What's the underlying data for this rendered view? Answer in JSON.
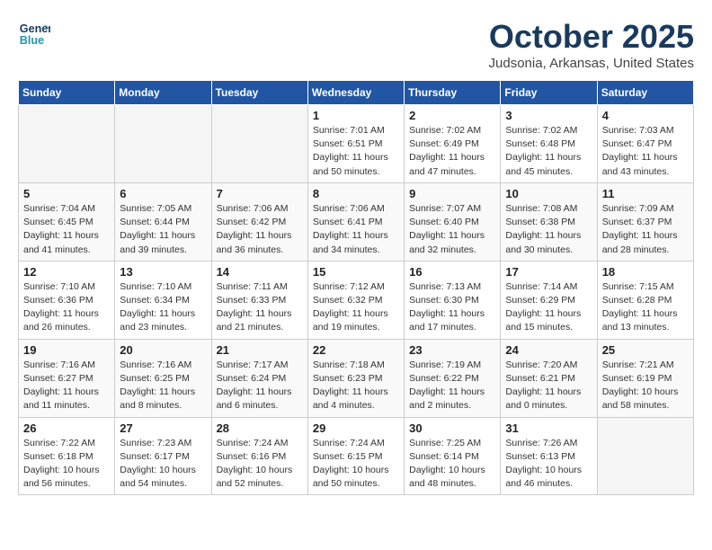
{
  "logo": {
    "line1": "General",
    "line2": "Blue"
  },
  "title": "October 2025",
  "subtitle": "Judsonia, Arkansas, United States",
  "headers": [
    "Sunday",
    "Monday",
    "Tuesday",
    "Wednesday",
    "Thursday",
    "Friday",
    "Saturday"
  ],
  "weeks": [
    [
      {
        "day": "",
        "info": ""
      },
      {
        "day": "",
        "info": ""
      },
      {
        "day": "",
        "info": ""
      },
      {
        "day": "1",
        "info": "Sunrise: 7:01 AM\nSunset: 6:51 PM\nDaylight: 11 hours\nand 50 minutes."
      },
      {
        "day": "2",
        "info": "Sunrise: 7:02 AM\nSunset: 6:49 PM\nDaylight: 11 hours\nand 47 minutes."
      },
      {
        "day": "3",
        "info": "Sunrise: 7:02 AM\nSunset: 6:48 PM\nDaylight: 11 hours\nand 45 minutes."
      },
      {
        "day": "4",
        "info": "Sunrise: 7:03 AM\nSunset: 6:47 PM\nDaylight: 11 hours\nand 43 minutes."
      }
    ],
    [
      {
        "day": "5",
        "info": "Sunrise: 7:04 AM\nSunset: 6:45 PM\nDaylight: 11 hours\nand 41 minutes."
      },
      {
        "day": "6",
        "info": "Sunrise: 7:05 AM\nSunset: 6:44 PM\nDaylight: 11 hours\nand 39 minutes."
      },
      {
        "day": "7",
        "info": "Sunrise: 7:06 AM\nSunset: 6:42 PM\nDaylight: 11 hours\nand 36 minutes."
      },
      {
        "day": "8",
        "info": "Sunrise: 7:06 AM\nSunset: 6:41 PM\nDaylight: 11 hours\nand 34 minutes."
      },
      {
        "day": "9",
        "info": "Sunrise: 7:07 AM\nSunset: 6:40 PM\nDaylight: 11 hours\nand 32 minutes."
      },
      {
        "day": "10",
        "info": "Sunrise: 7:08 AM\nSunset: 6:38 PM\nDaylight: 11 hours\nand 30 minutes."
      },
      {
        "day": "11",
        "info": "Sunrise: 7:09 AM\nSunset: 6:37 PM\nDaylight: 11 hours\nand 28 minutes."
      }
    ],
    [
      {
        "day": "12",
        "info": "Sunrise: 7:10 AM\nSunset: 6:36 PM\nDaylight: 11 hours\nand 26 minutes."
      },
      {
        "day": "13",
        "info": "Sunrise: 7:10 AM\nSunset: 6:34 PM\nDaylight: 11 hours\nand 23 minutes."
      },
      {
        "day": "14",
        "info": "Sunrise: 7:11 AM\nSunset: 6:33 PM\nDaylight: 11 hours\nand 21 minutes."
      },
      {
        "day": "15",
        "info": "Sunrise: 7:12 AM\nSunset: 6:32 PM\nDaylight: 11 hours\nand 19 minutes."
      },
      {
        "day": "16",
        "info": "Sunrise: 7:13 AM\nSunset: 6:30 PM\nDaylight: 11 hours\nand 17 minutes."
      },
      {
        "day": "17",
        "info": "Sunrise: 7:14 AM\nSunset: 6:29 PM\nDaylight: 11 hours\nand 15 minutes."
      },
      {
        "day": "18",
        "info": "Sunrise: 7:15 AM\nSunset: 6:28 PM\nDaylight: 11 hours\nand 13 minutes."
      }
    ],
    [
      {
        "day": "19",
        "info": "Sunrise: 7:16 AM\nSunset: 6:27 PM\nDaylight: 11 hours\nand 11 minutes."
      },
      {
        "day": "20",
        "info": "Sunrise: 7:16 AM\nSunset: 6:25 PM\nDaylight: 11 hours\nand 8 minutes."
      },
      {
        "day": "21",
        "info": "Sunrise: 7:17 AM\nSunset: 6:24 PM\nDaylight: 11 hours\nand 6 minutes."
      },
      {
        "day": "22",
        "info": "Sunrise: 7:18 AM\nSunset: 6:23 PM\nDaylight: 11 hours\nand 4 minutes."
      },
      {
        "day": "23",
        "info": "Sunrise: 7:19 AM\nSunset: 6:22 PM\nDaylight: 11 hours\nand 2 minutes."
      },
      {
        "day": "24",
        "info": "Sunrise: 7:20 AM\nSunset: 6:21 PM\nDaylight: 11 hours\nand 0 minutes."
      },
      {
        "day": "25",
        "info": "Sunrise: 7:21 AM\nSunset: 6:19 PM\nDaylight: 10 hours\nand 58 minutes."
      }
    ],
    [
      {
        "day": "26",
        "info": "Sunrise: 7:22 AM\nSunset: 6:18 PM\nDaylight: 10 hours\nand 56 minutes."
      },
      {
        "day": "27",
        "info": "Sunrise: 7:23 AM\nSunset: 6:17 PM\nDaylight: 10 hours\nand 54 minutes."
      },
      {
        "day": "28",
        "info": "Sunrise: 7:24 AM\nSunset: 6:16 PM\nDaylight: 10 hours\nand 52 minutes."
      },
      {
        "day": "29",
        "info": "Sunrise: 7:24 AM\nSunset: 6:15 PM\nDaylight: 10 hours\nand 50 minutes."
      },
      {
        "day": "30",
        "info": "Sunrise: 7:25 AM\nSunset: 6:14 PM\nDaylight: 10 hours\nand 48 minutes."
      },
      {
        "day": "31",
        "info": "Sunrise: 7:26 AM\nSunset: 6:13 PM\nDaylight: 10 hours\nand 46 minutes."
      },
      {
        "day": "",
        "info": ""
      }
    ]
  ]
}
